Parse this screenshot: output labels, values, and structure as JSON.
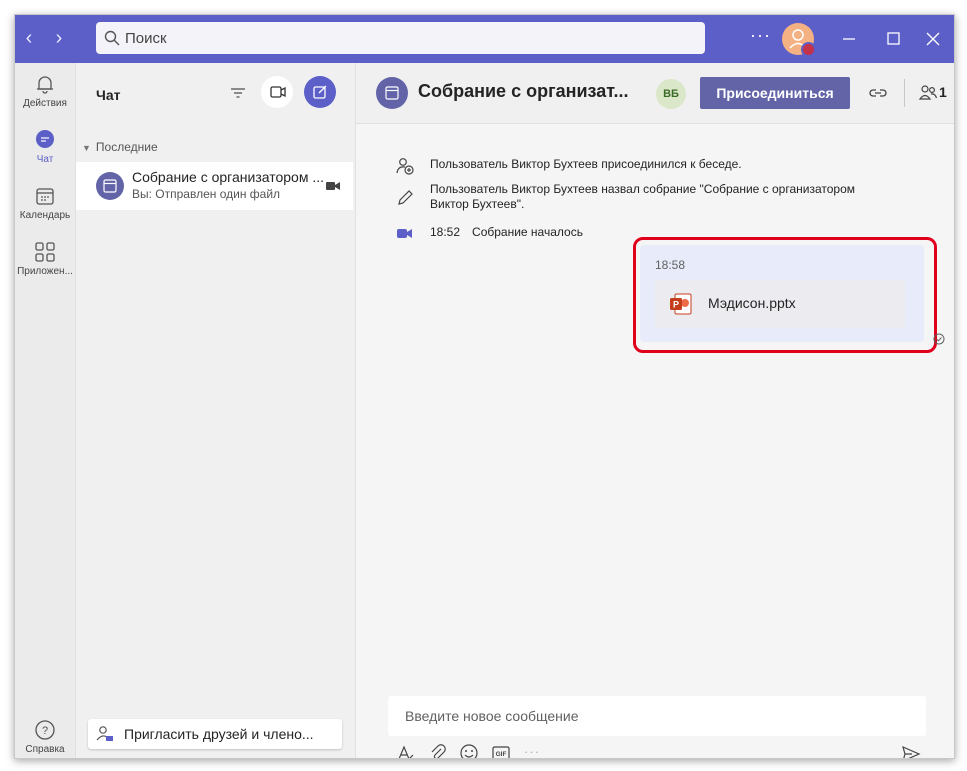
{
  "search": {
    "placeholder": "Поиск"
  },
  "colors": {
    "accent": "#5b5fc7",
    "teams_purple": "#6264a7",
    "highlight_red": "#e0001b",
    "status_busy": "#c4314b"
  },
  "rail": {
    "items": [
      {
        "label": "Действия",
        "icon": "bell-icon"
      },
      {
        "label": "Чат",
        "icon": "chat-icon"
      },
      {
        "label": "Календарь",
        "icon": "calendar-icon"
      },
      {
        "label": "Приложен...",
        "icon": "apps-icon"
      }
    ],
    "help_label": "Справка"
  },
  "chat_list": {
    "title": "Чат",
    "section_label": "Последние",
    "items": [
      {
        "name": "Собрание с организатором ...",
        "preview": "Вы: Отправлен один файл"
      }
    ],
    "invite_label": "Пригласить друзей и члено..."
  },
  "header": {
    "title": "Собрание с организат...",
    "participant_initials": "ВБ",
    "join_label": "Присоединиться",
    "participant_count": "1"
  },
  "conversation": {
    "events": [
      {
        "text": "Пользователь Виктор Бухтеев присоединился к беседе."
      },
      {
        "text_line1": "Пользователь Виктор Бухтеев назвал собрание \"Собрание с организатором",
        "text_line2": "Виктор Бухтеев\"."
      },
      {
        "time": "18:52",
        "text": "Собрание началось"
      }
    ],
    "message": {
      "time": "18:58",
      "file_name": "Мэдисон.pptx"
    }
  },
  "composer": {
    "placeholder": "Введите новое сообщение"
  }
}
